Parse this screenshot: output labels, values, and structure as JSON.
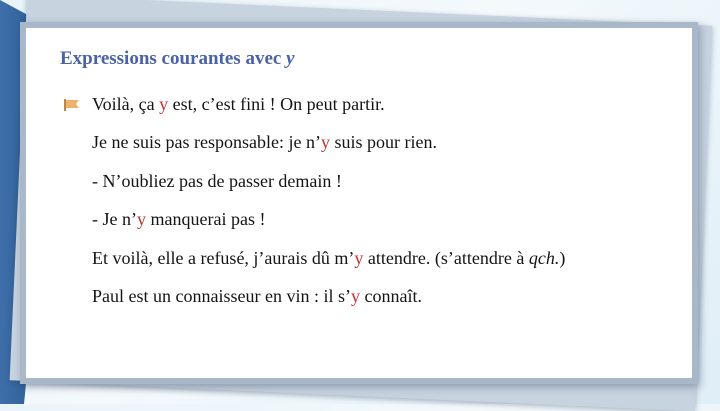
{
  "slide": {
    "title_main": "Expressions courantes avec ",
    "title_y": "y",
    "bullet_icon": "flag-bullet-icon",
    "lines": [
      {
        "a": "Voilà, ça ",
        "y": "y",
        "b": " est, c’est fini ! On peut partir."
      },
      {
        "a": "Je ne suis pas responsable: je n’",
        "y": "y",
        "b": " suis pour rien."
      },
      {
        "a": "- N’oubliez pas de passer demain !"
      },
      {
        "a": "- Je n’",
        "y": "y",
        "b": " manquerai pas !"
      },
      {
        "a": "Et voilà, elle a refusé, j’aurais dû m’",
        "y": "y",
        "b": " attendre. (s’attendre à ",
        "i": "qch.",
        "c": ")"
      },
      {
        "a": "Paul est un connaisseur en vin : il s’",
        "y": "y",
        "b": " connaît."
      }
    ],
    "colors": {
      "title": "#4a62a6",
      "highlight": "#c43030",
      "text": "#141414"
    }
  }
}
